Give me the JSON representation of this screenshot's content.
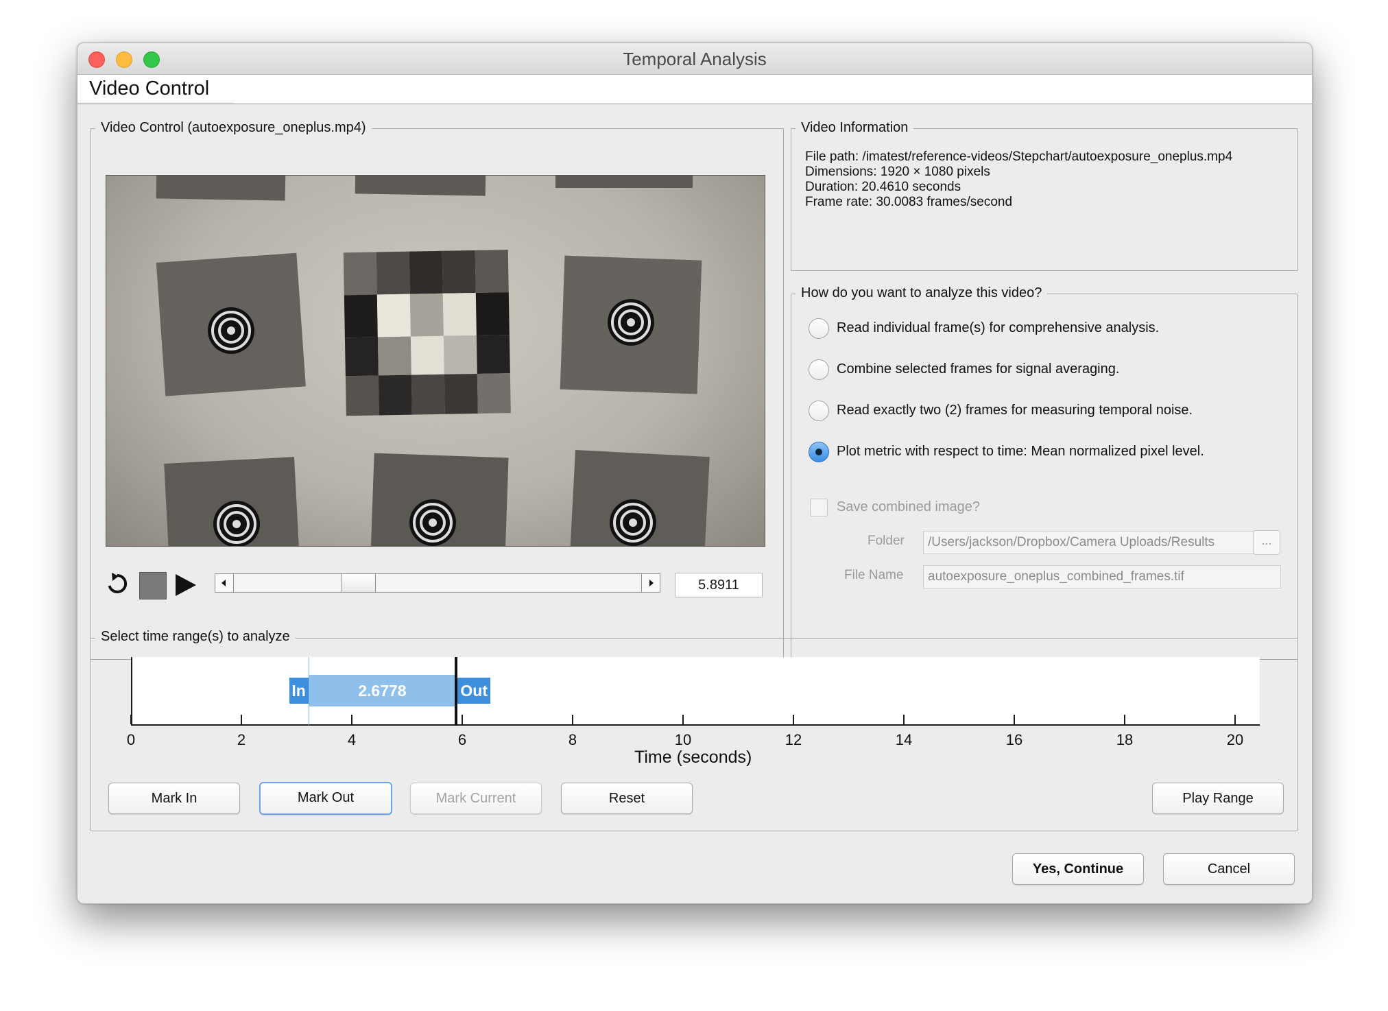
{
  "window": {
    "title": "Temporal Analysis"
  },
  "tab": {
    "label": "Video Control"
  },
  "video_panel": {
    "title": "Video Control (autoexposure_oneplus.mp4)",
    "current_time": "5.8911",
    "slider_position_fraction": 0.288
  },
  "video_info": {
    "title": "Video Information",
    "file_path": "File path: /imatest/reference-videos/Stepchart/autoexposure_oneplus.mp4",
    "dimensions": "Dimensions: 1920 × 1080 pixels",
    "duration": "Duration: 20.4610 seconds",
    "frame_rate": "Frame rate: 30.0083 frames/second"
  },
  "analysis": {
    "title": "How do you want to analyze this video?",
    "options": [
      {
        "label": "Read individual frame(s) for comprehensive analysis.",
        "selected": false
      },
      {
        "label": "Combine selected frames for signal averaging.",
        "selected": false
      },
      {
        "label": "Read exactly two (2) frames for measuring temporal noise.",
        "selected": false
      },
      {
        "label": "Plot metric with respect to time: Mean normalized pixel level.",
        "selected": true
      }
    ],
    "save_combined_label": "Save combined image?",
    "folder_label": "Folder",
    "folder_value": "/Users/jackson/Dropbox/Camera Uploads/Results",
    "browse_label": "...",
    "filename_label": "File Name",
    "filename_value": "autoexposure_oneplus_combined_frames.tif"
  },
  "time_range": {
    "title": "Select time range(s) to analyze",
    "in_label": "In",
    "out_label": "Out",
    "range_duration": "2.6778",
    "in_time": 3.2133,
    "out_time": 5.8911,
    "x_ticks": [
      "0",
      "2",
      "4",
      "6",
      "8",
      "10",
      "12",
      "14",
      "16",
      "18",
      "20"
    ],
    "x_max": 20.461,
    "xlabel": "Time (seconds)",
    "buttons": {
      "mark_in": "Mark In",
      "mark_out": "Mark Out",
      "mark_current": "Mark Current",
      "reset": "Reset",
      "play_range": "Play Range"
    }
  },
  "footer": {
    "continue_label": "Yes, Continue",
    "cancel_label": "Cancel"
  },
  "colors": {
    "range_fill": "#8fc0ec",
    "marker": "#3d8fdc",
    "radio_selected": "#3a8ee6"
  }
}
